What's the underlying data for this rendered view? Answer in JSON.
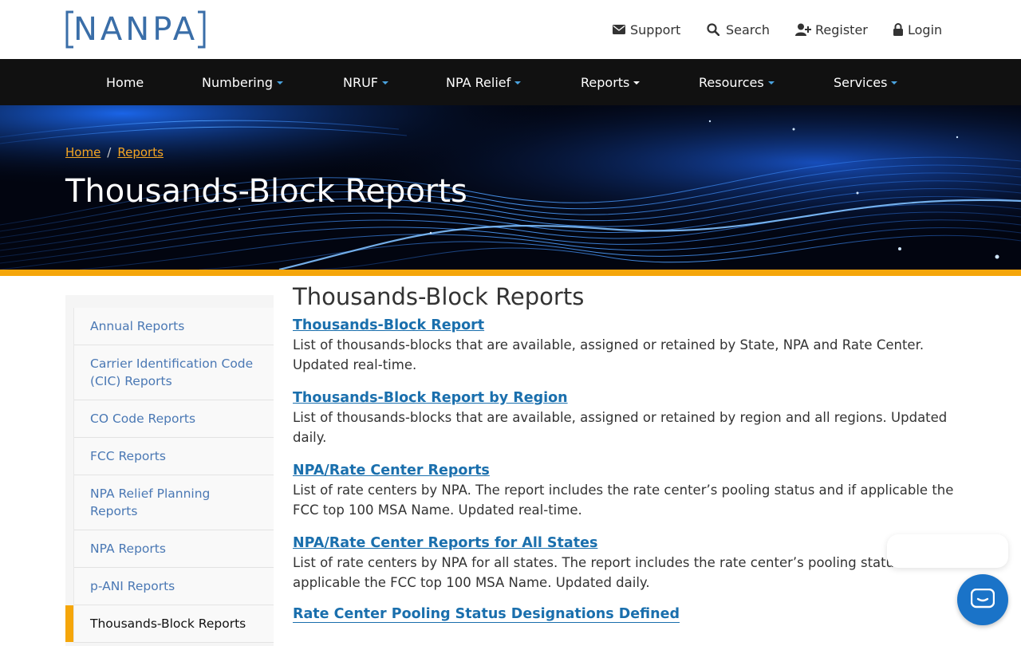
{
  "brand": {
    "logo_text": "NANPA"
  },
  "utility": {
    "support": "Support",
    "search": "Search",
    "register": "Register",
    "login": "Login"
  },
  "nav": [
    {
      "label": "Home"
    },
    {
      "label": "Numbering"
    },
    {
      "label": "NRUF"
    },
    {
      "label": "NPA Relief"
    },
    {
      "label": "Reports"
    },
    {
      "label": "Resources"
    },
    {
      "label": "Services"
    }
  ],
  "breadcrumb": {
    "home": "Home",
    "sep": "/",
    "reports": "Reports"
  },
  "hero": {
    "title": "Thousands-Block Reports"
  },
  "sidebar": {
    "items": [
      {
        "label": "Annual Reports"
      },
      {
        "label": "Carrier Identification Code (CIC) Reports"
      },
      {
        "label": "CO Code Reports"
      },
      {
        "label": "FCC Reports"
      },
      {
        "label": "NPA Relief Planning Reports"
      },
      {
        "label": "NPA Reports"
      },
      {
        "label": "p-ANI Reports"
      },
      {
        "label": "Thousands-Block Reports"
      }
    ]
  },
  "main": {
    "heading": "Thousands-Block Reports",
    "entries": [
      {
        "title": "Thousands-Block Report",
        "desc": "List of thousands-blocks that are available, assigned or retained by State, NPA and Rate Center. Updated real-time."
      },
      {
        "title": "Thousands-Block Report by Region",
        "desc": "List of thousands-blocks that are available, assigned or retained by region and all regions. Updated daily."
      },
      {
        "title": "NPA/Rate Center Reports",
        "desc": "List of rate centers by NPA. The report includes the rate center’s pooling status and if applicable the FCC top 100 MSA Name. Updated real-time."
      },
      {
        "title": "NPA/Rate Center Reports for All States",
        "desc": "List of rate centers by NPA for all states. The report includes the rate center’s pooling status and if applicable the FCC top 100 MSA Name. Updated daily."
      },
      {
        "title": "Rate Center Pooling Status Designations Defined",
        "desc": ""
      }
    ]
  },
  "colors": {
    "accent": "#f5a60a",
    "link": "#1a6fad",
    "nav_bg": "#111111",
    "chat": "#1a73c8"
  }
}
